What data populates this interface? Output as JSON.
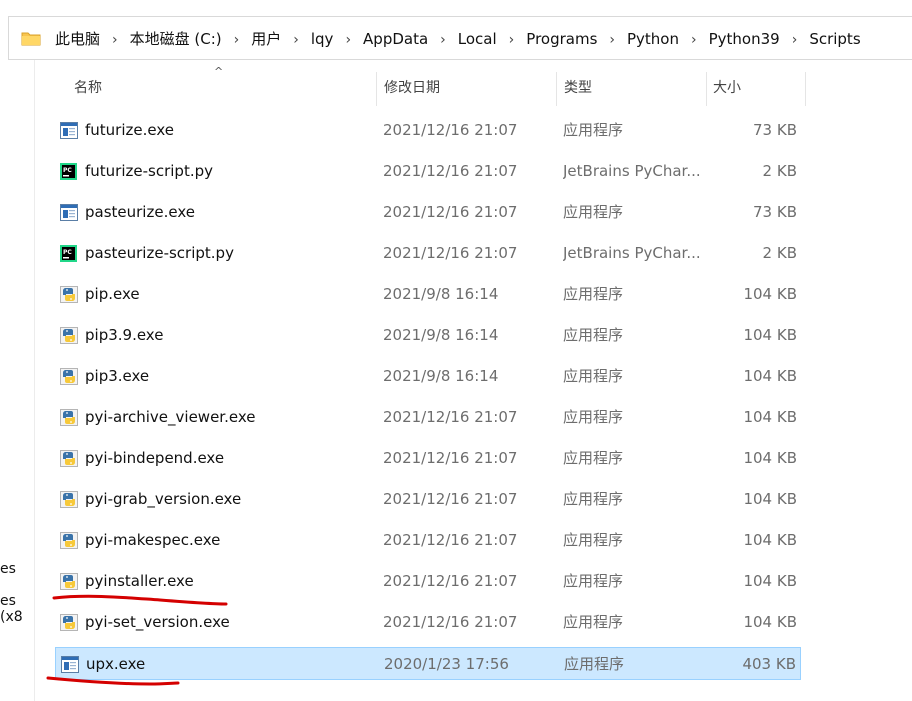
{
  "breadcrumb": [
    "此电脑",
    "本地磁盘 (C:)",
    "用户",
    "lqy",
    "AppData",
    "Local",
    "Programs",
    "Python",
    "Python39",
    "Scripts"
  ],
  "separator": "›",
  "left_pane": [
    "es",
    "es (x8"
  ],
  "columns": {
    "name": "名称",
    "date": "修改日期",
    "type": "类型",
    "size": "大小"
  },
  "sort_indicator": "^",
  "files": [
    {
      "name": "futurize.exe",
      "date": "2021/12/16 21:07",
      "type": "应用程序",
      "size": "73 KB",
      "icon": "exe-window-icon"
    },
    {
      "name": "futurize-script.py",
      "date": "2021/12/16 21:07",
      "type": "JetBrains PyChar...",
      "size": "2 KB",
      "icon": "pycharm-file-icon"
    },
    {
      "name": "pasteurize.exe",
      "date": "2021/12/16 21:07",
      "type": "应用程序",
      "size": "73 KB",
      "icon": "exe-window-icon"
    },
    {
      "name": "pasteurize-script.py",
      "date": "2021/12/16 21:07",
      "type": "JetBrains PyChar...",
      "size": "2 KB",
      "icon": "pycharm-file-icon"
    },
    {
      "name": "pip.exe",
      "date": "2021/9/8 16:14",
      "type": "应用程序",
      "size": "104 KB",
      "icon": "python-exe-icon"
    },
    {
      "name": "pip3.9.exe",
      "date": "2021/9/8 16:14",
      "type": "应用程序",
      "size": "104 KB",
      "icon": "python-exe-icon"
    },
    {
      "name": "pip3.exe",
      "date": "2021/9/8 16:14",
      "type": "应用程序",
      "size": "104 KB",
      "icon": "python-exe-icon"
    },
    {
      "name": "pyi-archive_viewer.exe",
      "date": "2021/12/16 21:07",
      "type": "应用程序",
      "size": "104 KB",
      "icon": "python-exe-icon"
    },
    {
      "name": "pyi-bindepend.exe",
      "date": "2021/12/16 21:07",
      "type": "应用程序",
      "size": "104 KB",
      "icon": "python-exe-icon"
    },
    {
      "name": "pyi-grab_version.exe",
      "date": "2021/12/16 21:07",
      "type": "应用程序",
      "size": "104 KB",
      "icon": "python-exe-icon"
    },
    {
      "name": "pyi-makespec.exe",
      "date": "2021/12/16 21:07",
      "type": "应用程序",
      "size": "104 KB",
      "icon": "python-exe-icon"
    },
    {
      "name": "pyinstaller.exe",
      "date": "2021/12/16 21:07",
      "type": "应用程序",
      "size": "104 KB",
      "icon": "python-exe-icon",
      "annotated": true
    },
    {
      "name": "pyi-set_version.exe",
      "date": "2021/12/16 21:07",
      "type": "应用程序",
      "size": "104 KB",
      "icon": "python-exe-icon"
    },
    {
      "name": "upx.exe",
      "date": "2020/1/23 17:56",
      "type": "应用程序",
      "size": "403 KB",
      "icon": "exe-window-icon",
      "selected": true,
      "annotated": true
    }
  ],
  "colors": {
    "selection_bg": "#cce8ff",
    "selection_border": "#99d1ff",
    "annotation_red": "#d40000",
    "folder_yellow": "#f8c44f"
  }
}
